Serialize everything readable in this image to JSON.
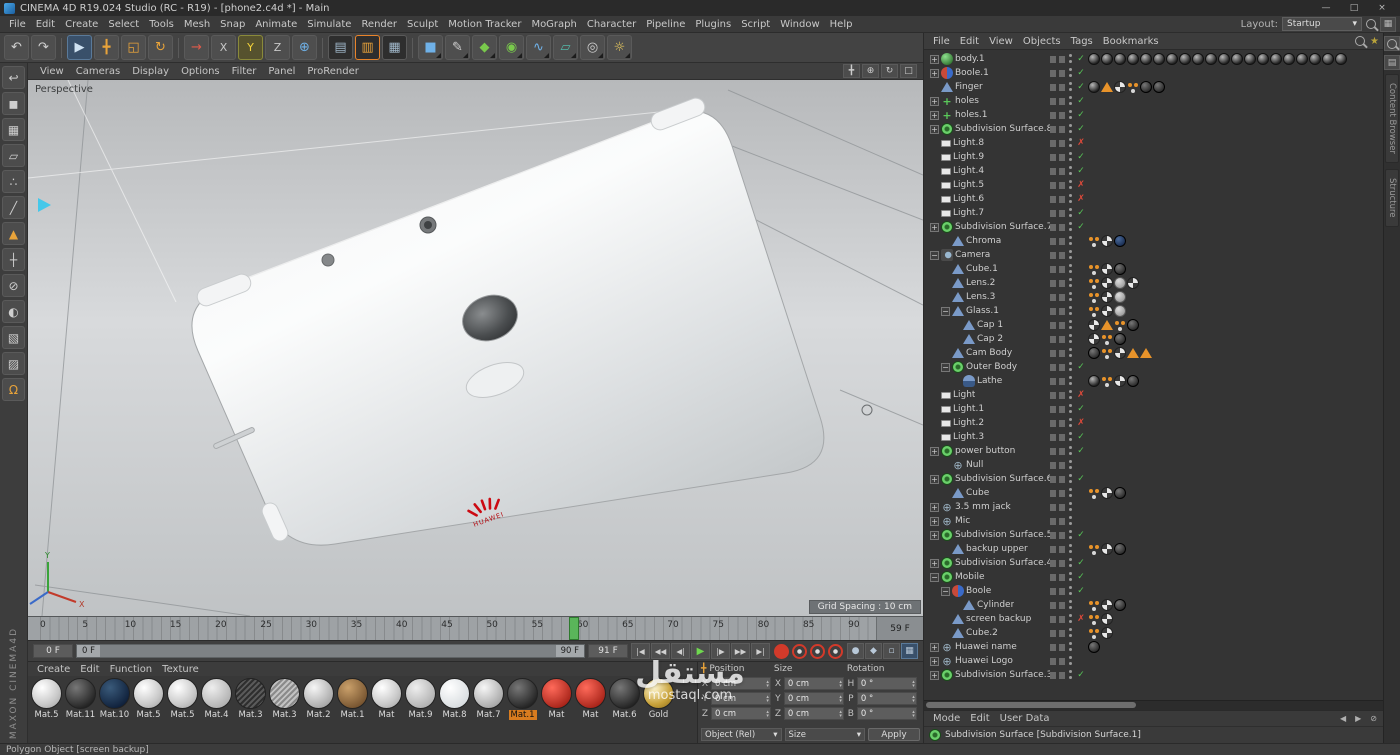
{
  "window": {
    "title": "CINEMA 4D R19.024 Studio (RC - R19) - [phone2.c4d *] - Main",
    "controls": [
      {
        "name": "minimize-button",
        "glyph": "—"
      },
      {
        "name": "maximize-button",
        "glyph": "□"
      },
      {
        "name": "close-button",
        "glyph": "×"
      }
    ]
  },
  "menu_bar": {
    "items": [
      "File",
      "Edit",
      "Create",
      "Select",
      "Tools",
      "Mesh",
      "Snap",
      "Animate",
      "Simulate",
      "Render",
      "Sculpt",
      "Motion Tracker",
      "MoGraph",
      "Character",
      "Pipeline",
      "Plugins",
      "Script",
      "Window",
      "Help"
    ],
    "layout_label": "Layout:",
    "layout_value": "Startup"
  },
  "toolbar": {
    "icons": [
      {
        "name": "undo-icon",
        "glyph": "↶",
        "style": ""
      },
      {
        "name": "redo-icon",
        "glyph": "↷",
        "style": ""
      },
      {
        "sep": true
      },
      {
        "name": "live-selection-tool",
        "glyph": "▶",
        "style": "selblue"
      },
      {
        "name": "move-tool",
        "glyph": "╋",
        "style": "orange"
      },
      {
        "name": "scale-tool",
        "glyph": "◱",
        "style": "orange"
      },
      {
        "name": "rotate-tool",
        "glyph": "↻",
        "style": "orange"
      },
      {
        "sep": true
      },
      {
        "name": "last-used-tool",
        "glyph": "→",
        "style": "red"
      },
      {
        "name": "axis-x-lock",
        "glyph": "X",
        "style": "axis"
      },
      {
        "name": "axis-y-lock",
        "glyph": "Y",
        "style": "axis active"
      },
      {
        "name": "axis-z-lock",
        "glyph": "Z",
        "style": "axis"
      },
      {
        "name": "coordinate-system-toggle",
        "glyph": "⊕",
        "style": "blue"
      },
      {
        "sep": true
      },
      {
        "name": "render-view-button",
        "glyph": "▤",
        "style": "dark"
      },
      {
        "name": "render-picture-viewer-button",
        "glyph": "▥",
        "style": "dark sel"
      },
      {
        "name": "render-settings-button",
        "glyph": "▦",
        "style": "dark"
      },
      {
        "sep": true
      },
      {
        "name": "primitive-cube-menu",
        "glyph": "■",
        "style": "blue dd"
      },
      {
        "name": "spline-pen-menu",
        "glyph": "✎",
        "style": "dd"
      },
      {
        "name": "mograph-menu",
        "glyph": "◆",
        "style": "green dd"
      },
      {
        "name": "simulate-menu",
        "glyph": "◉",
        "style": "green dd"
      },
      {
        "name": "hair-menu",
        "glyph": "∿",
        "style": "blue dd"
      },
      {
        "name": "floor-menu",
        "glyph": "▱",
        "style": "teal dd"
      },
      {
        "name": "camera-menu",
        "glyph": "◎",
        "style": "dd"
      },
      {
        "name": "light-menu",
        "glyph": "☼",
        "style": "yellow dd"
      }
    ]
  },
  "left_toolbar": {
    "icons": [
      {
        "name": "make-editable-icon",
        "glyph": "↩",
        "style": ""
      },
      {
        "name": "model-mode-icon",
        "glyph": "◼",
        "style": ""
      },
      {
        "name": "texture-mode-icon",
        "glyph": "▦",
        "style": ""
      },
      {
        "name": "workplane-mode-icon",
        "glyph": "▱",
        "style": ""
      },
      {
        "name": "points-mode-icon",
        "glyph": "∴",
        "style": ""
      },
      {
        "name": "edges-mode-icon",
        "glyph": "╱",
        "style": ""
      },
      {
        "name": "polygons-mode-icon",
        "glyph": "▲",
        "style": "orange"
      },
      {
        "name": "tweak-mode-icon",
        "glyph": "┼",
        "style": ""
      },
      {
        "name": "axis-lock-icon",
        "glyph": "⊘",
        "style": ""
      },
      {
        "name": "solo-mode-icon",
        "glyph": "◐",
        "style": ""
      },
      {
        "name": "viewport-filter-icon",
        "glyph": "▧",
        "style": ""
      },
      {
        "name": "texture-paint-icon",
        "glyph": "▨",
        "style": ""
      },
      {
        "name": "snap-magnet-icon",
        "glyph": "Ω",
        "style": "orange"
      }
    ]
  },
  "viewport": {
    "menu": [
      "View",
      "Cameras",
      "Display",
      "Options",
      "Filter",
      "Panel",
      "ProRender"
    ],
    "view_label": "Perspective",
    "grid_spacing": "Grid Spacing : 10 cm",
    "nav_icons": [
      {
        "name": "pan-view-icon",
        "glyph": "╋"
      },
      {
        "name": "zoom-view-icon",
        "glyph": "⊕"
      },
      {
        "name": "rotate-view-icon",
        "glyph": "↻"
      },
      {
        "name": "toggle-view-icon",
        "glyph": "□"
      }
    ]
  },
  "timeline": {
    "ticks": [
      "0",
      "5",
      "10",
      "15",
      "20",
      "25",
      "30",
      "35",
      "40",
      "45",
      "50",
      "55",
      "60",
      "65",
      "70",
      "75",
      "80",
      "85",
      "90"
    ],
    "max": 92,
    "current_frame": 59,
    "current_frame_label": "59 F",
    "start_value": "0 F",
    "range_start": "0 F",
    "range_end": "90 F",
    "end_value": "91 F",
    "transport": [
      {
        "name": "go-to-start-button",
        "glyph": "|◀"
      },
      {
        "name": "previous-key-button",
        "glyph": "◀◀"
      },
      {
        "name": "previous-frame-button",
        "glyph": "◀|"
      },
      {
        "name": "play-button",
        "glyph": "▶",
        "style": "play"
      },
      {
        "name": "next-frame-button",
        "glyph": "|▶"
      },
      {
        "name": "next-key-button",
        "glyph": "▶▶"
      },
      {
        "name": "go-to-end-button",
        "glyph": "▶|"
      }
    ],
    "record_buttons": [
      {
        "name": "record-keyframe-button",
        "style": "solid"
      },
      {
        "name": "record-position-button",
        "style": "ring"
      },
      {
        "name": "record-scale-button",
        "style": "ring"
      },
      {
        "name": "record-rotation-button",
        "style": "ring"
      }
    ],
    "toggles": [
      {
        "name": "autokey-toggle",
        "glyph": "●",
        "style": ""
      },
      {
        "name": "keyframe-selection-toggle",
        "glyph": "◆",
        "style": ""
      },
      {
        "name": "hud-toggle",
        "glyph": "▫",
        "style": ""
      },
      {
        "name": "keyframe-grid-button",
        "glyph": "▦",
        "style": "bluish"
      }
    ]
  },
  "materials": {
    "menu": [
      "Create",
      "Edit",
      "Function",
      "Texture"
    ],
    "items": [
      {
        "label": "Mat.5",
        "style": "white"
      },
      {
        "label": "Mat.11",
        "style": "black"
      },
      {
        "label": "Mat.10",
        "style": "navy"
      },
      {
        "label": "Mat.5",
        "style": "white"
      },
      {
        "label": "Mat.5",
        "style": "white"
      },
      {
        "label": "Mat.4",
        "style": "lightgray"
      },
      {
        "label": "Mat.3",
        "style": "brushed-dark"
      },
      {
        "label": "Mat.3",
        "style": "brushed"
      },
      {
        "label": "Mat.2",
        "style": "silver"
      },
      {
        "label": "Mat.1",
        "style": "bronze"
      },
      {
        "label": "Mat",
        "style": "white"
      },
      {
        "label": "Mat.9",
        "style": "lightgray"
      },
      {
        "label": "Mat.8",
        "style": "pearl"
      },
      {
        "label": "Mat.7",
        "style": "silver"
      },
      {
        "label": "Mat.1",
        "style": "black",
        "selected": true
      },
      {
        "label": "Mat",
        "style": "red"
      },
      {
        "label": "Mat",
        "style": "red"
      },
      {
        "label": "Mat.6",
        "style": "black"
      },
      {
        "label": "Gold",
        "style": "gold"
      }
    ]
  },
  "coordinates": {
    "columns": [
      {
        "header": "Position",
        "rows": [
          {
            "label": "X",
            "value": "0 cm"
          },
          {
            "label": "Y",
            "value": "0 cm"
          },
          {
            "label": "Z",
            "value": "0 cm"
          }
        ]
      },
      {
        "header": "Size",
        "rows": [
          {
            "label": "X",
            "value": "0 cm"
          },
          {
            "label": "Y",
            "value": "0 cm"
          },
          {
            "label": "Z",
            "value": "0 cm"
          }
        ]
      },
      {
        "header": "Rotation",
        "rows": [
          {
            "label": "H",
            "value": "0 °"
          },
          {
            "label": "P",
            "value": "0 °"
          },
          {
            "label": "B",
            "value": "0 °"
          }
        ]
      }
    ],
    "object_mode": "Object (Rel)",
    "size_mode": "Size",
    "apply_label": "Apply"
  },
  "object_manager": {
    "menu": [
      "File",
      "Edit",
      "View",
      "Objects",
      "Tags",
      "Bookmarks"
    ],
    "rows": [
      {
        "n": "body.1",
        "lv": 0,
        "exp": "+",
        "ic": "sphere",
        "s": "c",
        "tags": [
          "photo",
          "photo",
          "photo",
          "photo",
          "photo",
          "photo",
          "photo",
          "photo",
          "photo",
          "photo",
          "photo",
          "photo",
          "photo",
          "photo",
          "photo",
          "photo",
          "photo",
          "photo",
          "photo",
          "photo"
        ]
      },
      {
        "n": "Boole.1",
        "lv": 0,
        "exp": "+",
        "ic": "boole",
        "s": "c",
        "tags": []
      },
      {
        "n": "Finger",
        "lv": 0,
        "exp": "",
        "ic": "poly",
        "s": "c",
        "tags": [
          "photo",
          "warn",
          "checker",
          "odots",
          "dark",
          "dark"
        ]
      },
      {
        "n": "holes",
        "lv": 0,
        "exp": "+",
        "ic": "plus",
        "s": "c",
        "tags": []
      },
      {
        "n": "holes.1",
        "lv": 0,
        "exp": "+",
        "ic": "plus",
        "s": "c",
        "tags": []
      },
      {
        "n": "Subdivision Surface.8",
        "lv": 0,
        "exp": "+",
        "ic": "subdiv",
        "s": "c",
        "tags": []
      },
      {
        "n": "Light.8",
        "lv": 0,
        "exp": "",
        "ic": "light",
        "s": "x",
        "tags": []
      },
      {
        "n": "Light.9",
        "lv": 0,
        "exp": "",
        "ic": "light",
        "s": "c",
        "tags": []
      },
      {
        "n": "Light.4",
        "lv": 0,
        "exp": "",
        "ic": "light",
        "s": "c",
        "tags": []
      },
      {
        "n": "Light.5",
        "lv": 0,
        "exp": "",
        "ic": "light",
        "s": "x",
        "tags": []
      },
      {
        "n": "Light.6",
        "lv": 0,
        "exp": "",
        "ic": "light",
        "s": "x",
        "tags": []
      },
      {
        "n": "Light.7",
        "lv": 0,
        "exp": "",
        "ic": "light",
        "s": "c",
        "tags": []
      },
      {
        "n": "Subdivision Surface.7",
        "lv": 0,
        "exp": "+",
        "ic": "subdiv",
        "s": "c",
        "tags": []
      },
      {
        "n": "Chroma",
        "lv": 1,
        "exp": "",
        "ic": "poly",
        "s": "",
        "tags": [
          "odots",
          "checker",
          "navy"
        ]
      },
      {
        "n": "Camera",
        "lv": 0,
        "exp": "-",
        "ic": "camera",
        "s": "",
        "tags": []
      },
      {
        "n": "Cube.1",
        "lv": 1,
        "exp": "",
        "ic": "poly",
        "s": "",
        "tags": [
          "odots",
          "checker",
          "dark"
        ]
      },
      {
        "n": "Lens.2",
        "lv": 1,
        "exp": "",
        "ic": "poly",
        "s": "",
        "tags": [
          "odots",
          "checker",
          "gray",
          "checker"
        ]
      },
      {
        "n": "Lens.3",
        "lv": 1,
        "exp": "",
        "ic": "poly",
        "s": "",
        "tags": [
          "odots",
          "checker",
          "gray"
        ]
      },
      {
        "n": "Glass.1",
        "lv": 1,
        "exp": "-",
        "ic": "poly",
        "s": "",
        "tags": [
          "odots",
          "checker",
          "gray"
        ]
      },
      {
        "n": "Cap 1",
        "lv": 2,
        "exp": "",
        "ic": "poly",
        "s": "",
        "tags": [
          "checker",
          "warn",
          "odots",
          "dark"
        ]
      },
      {
        "n": "Cap 2",
        "lv": 2,
        "exp": "",
        "ic": "poly",
        "s": "",
        "tags": [
          "checker",
          "odots",
          "dark"
        ]
      },
      {
        "n": "Cam Body",
        "lv": 1,
        "exp": "",
        "ic": "poly",
        "s": "",
        "tags": [
          "dark",
          "odots",
          "checker",
          "warn",
          "warn"
        ]
      },
      {
        "n": "Outer Body",
        "lv": 1,
        "exp": "-",
        "ic": "subdiv",
        "s": "c",
        "tags": []
      },
      {
        "n": "Lathe",
        "lv": 2,
        "exp": "",
        "ic": "lathe",
        "s": "",
        "tags": [
          "photo",
          "odots",
          "checker",
          "dark"
        ]
      },
      {
        "n": "Light",
        "lv": 0,
        "exp": "",
        "ic": "light",
        "s": "x",
        "tags": []
      },
      {
        "n": "Light.1",
        "lv": 0,
        "exp": "",
        "ic": "light",
        "s": "c",
        "tags": []
      },
      {
        "n": "Light.2",
        "lv": 0,
        "exp": "",
        "ic": "light",
        "s": "x",
        "tags": []
      },
      {
        "n": "Light.3",
        "lv": 0,
        "exp": "",
        "ic": "light",
        "s": "c",
        "tags": []
      },
      {
        "n": "power button",
        "lv": 0,
        "exp": "+",
        "ic": "subdiv",
        "s": "c",
        "tags": []
      },
      {
        "n": "Null",
        "lv": 1,
        "exp": "",
        "ic": "nullx",
        "s": "",
        "tags": []
      },
      {
        "n": "Subdivision Surface.6",
        "lv": 0,
        "exp": "+",
        "ic": "subdiv",
        "s": "c",
        "tags": []
      },
      {
        "n": "Cube",
        "lv": 1,
        "exp": "",
        "ic": "poly",
        "s": "",
        "tags": [
          "odots",
          "checker",
          "dark"
        ]
      },
      {
        "n": "3.5 mm jack",
        "lv": 0,
        "exp": "+",
        "ic": "nullx",
        "s": "",
        "tags": []
      },
      {
        "n": "Mic",
        "lv": 0,
        "exp": "+",
        "ic": "nullx",
        "s": "",
        "tags": []
      },
      {
        "n": "Subdivision Surface.5",
        "lv": 0,
        "exp": "+",
        "ic": "subdiv",
        "s": "c",
        "tags": []
      },
      {
        "n": "backup upper",
        "lv": 1,
        "exp": "",
        "ic": "poly",
        "s": "",
        "tags": [
          "odots",
          "checker",
          "dark"
        ]
      },
      {
        "n": "Subdivision Surface.4",
        "lv": 0,
        "exp": "+",
        "ic": "subdiv",
        "s": "c",
        "tags": []
      },
      {
        "n": "Mobile",
        "lv": 0,
        "exp": "-",
        "ic": "subdiv",
        "s": "c",
        "tags": []
      },
      {
        "n": "Boole",
        "lv": 1,
        "exp": "-",
        "ic": "boole",
        "s": "c",
        "tags": []
      },
      {
        "n": "Cylinder",
        "lv": 2,
        "exp": "",
        "ic": "poly",
        "s": "",
        "tags": [
          "odots",
          "checker",
          "dark"
        ]
      },
      {
        "n": "screen backup",
        "lv": 1,
        "exp": "",
        "ic": "poly",
        "s": "x",
        "tags": [
          "odots",
          "checker"
        ]
      },
      {
        "n": "Cube.2",
        "lv": 1,
        "exp": "",
        "ic": "poly",
        "s": "",
        "tags": [
          "odots",
          "checker"
        ]
      },
      {
        "n": "Huawei name",
        "lv": 0,
        "exp": "+",
        "ic": "nullx",
        "s": "",
        "tags": [
          "dark"
        ]
      },
      {
        "n": "Huawei Logo",
        "lv": 0,
        "exp": "+",
        "ic": "nullx",
        "s": "",
        "tags": []
      },
      {
        "n": "Subdivision Surface.3",
        "lv": 0,
        "exp": "+",
        "ic": "subdiv",
        "s": "c",
        "tags": []
      }
    ]
  },
  "right_tabs": {
    "labels": [
      "Content Browser",
      "Structure"
    ]
  },
  "attribute_manager": {
    "menu": [
      "Mode",
      "Edit",
      "User Data"
    ],
    "title": "Subdivision Surface [Subdivision Surface.1]"
  },
  "status_bar": {
    "text": "Polygon Object [screen backup]"
  },
  "branding": {
    "vertical_text": "MAXON CINEMA4D"
  },
  "watermark": {
    "line1": "مستقل",
    "line2": "mostaql.com"
  }
}
